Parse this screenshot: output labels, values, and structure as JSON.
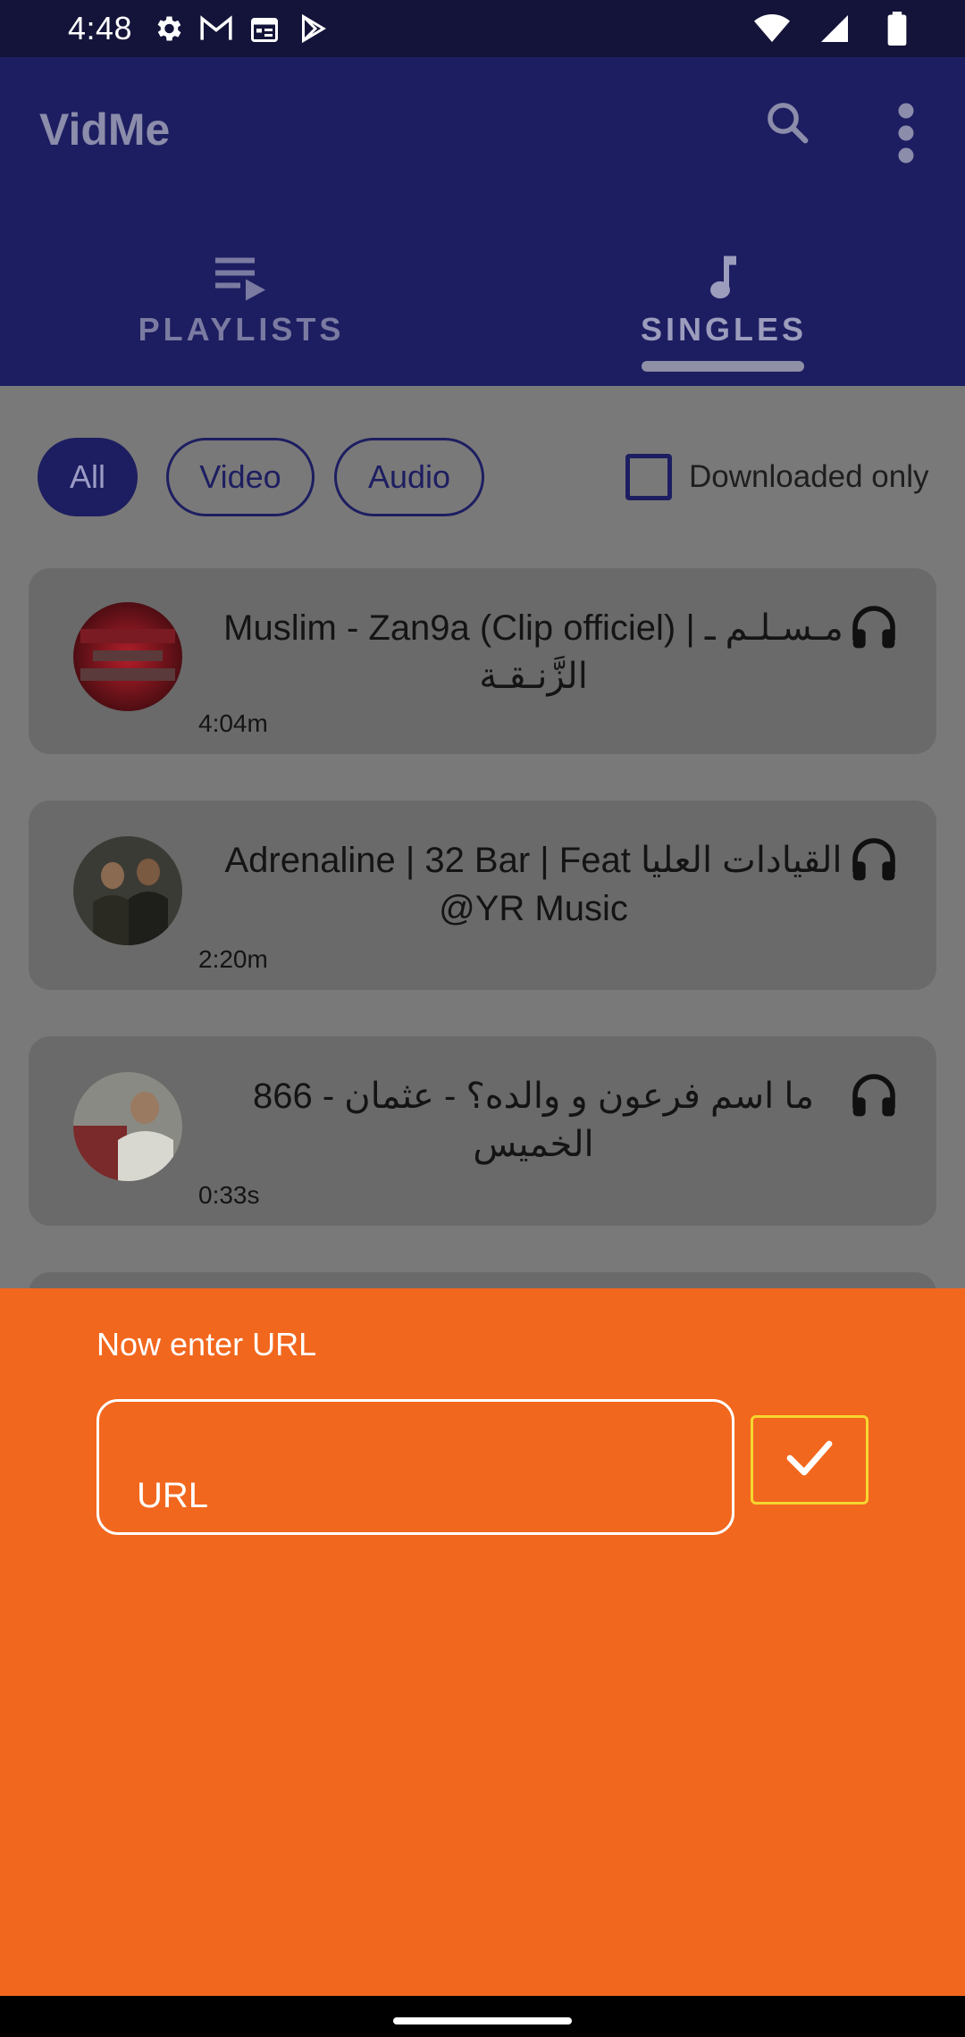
{
  "status_bar": {
    "time": "4:48",
    "icons_left": [
      "gear-icon",
      "gmail-icon",
      "calendar-icon",
      "play-store-icon"
    ],
    "icons_right": [
      "wifi-icon",
      "signal-icon",
      "battery-icon"
    ]
  },
  "app_bar": {
    "title": "VidMe",
    "actions": [
      "search-icon",
      "more-vert-icon"
    ]
  },
  "tabs": [
    {
      "label": "PLAYLISTS",
      "icon": "playlist-play-icon",
      "active": false
    },
    {
      "label": "SINGLES",
      "icon": "music-note-icon",
      "active": true
    }
  ],
  "filters": {
    "chips": [
      {
        "label": "All",
        "selected": true
      },
      {
        "label": "Video",
        "selected": false
      },
      {
        "label": "Audio",
        "selected": false
      }
    ],
    "downloaded_only_label": "Downloaded only",
    "downloaded_only_checked": false
  },
  "items": [
    {
      "title": "Muslim - Zan9a (Clip officiel)  |  مـسـلـم ـ الزَّنـقـة",
      "duration": "4:04m",
      "type_icon": "headphones-icon"
    },
    {
      "title": "Adrenaline | 32 Bar | Feat القيادات العليا @YR Music",
      "duration": "2:20m",
      "type_icon": "headphones-icon"
    },
    {
      "title": "866 - ما اسم فرعون و والده؟ - عثمان الخميس",
      "duration": "0:33s",
      "type_icon": "headphones-icon"
    }
  ],
  "url_sheet": {
    "prompt": "Now enter URL",
    "placeholder": "URL",
    "value": "",
    "confirm_icon": "check-icon"
  },
  "colors": {
    "app_bar": "#1d1e61",
    "status_bar": "#14143a",
    "sheet_background": "#f2671e",
    "confirm_border": "#f5d630",
    "scrim_content": "#7a7979"
  }
}
